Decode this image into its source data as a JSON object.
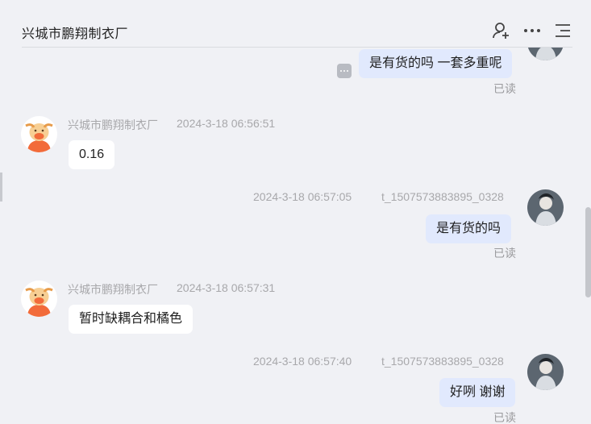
{
  "header": {
    "title": "兴城市鹏翔制衣厂",
    "icons": [
      "add-contact-icon",
      "more-icon",
      "menu-list-icon"
    ]
  },
  "messages": [
    {
      "direction": "out",
      "text": "是有货的吗 一套多重呢",
      "status": "已读"
    },
    {
      "direction": "in",
      "sender": "兴城市鹏翔制衣厂",
      "time": "2024-3-18 06:56:51",
      "text": "0.16"
    },
    {
      "direction": "out",
      "sender": "t_1507573883895_0328",
      "time": "2024-3-18 06:57:05",
      "text": "是有货的吗",
      "status": "已读"
    },
    {
      "direction": "in",
      "sender": "兴城市鹏翔制衣厂",
      "time": "2024-3-18 06:57:31",
      "text": "暂时缺耦合和橘色"
    },
    {
      "direction": "out",
      "sender": "t_1507573883895_0328",
      "time": "2024-3-18 06:57:40",
      "text": "好咧 谢谢",
      "status": "已读"
    }
  ],
  "colors": {
    "background": "#f0f1f5",
    "incoming_bubble": "#ffffff",
    "outgoing_bubble": "#e1e9fd",
    "meta_text": "#a8a8ab"
  }
}
